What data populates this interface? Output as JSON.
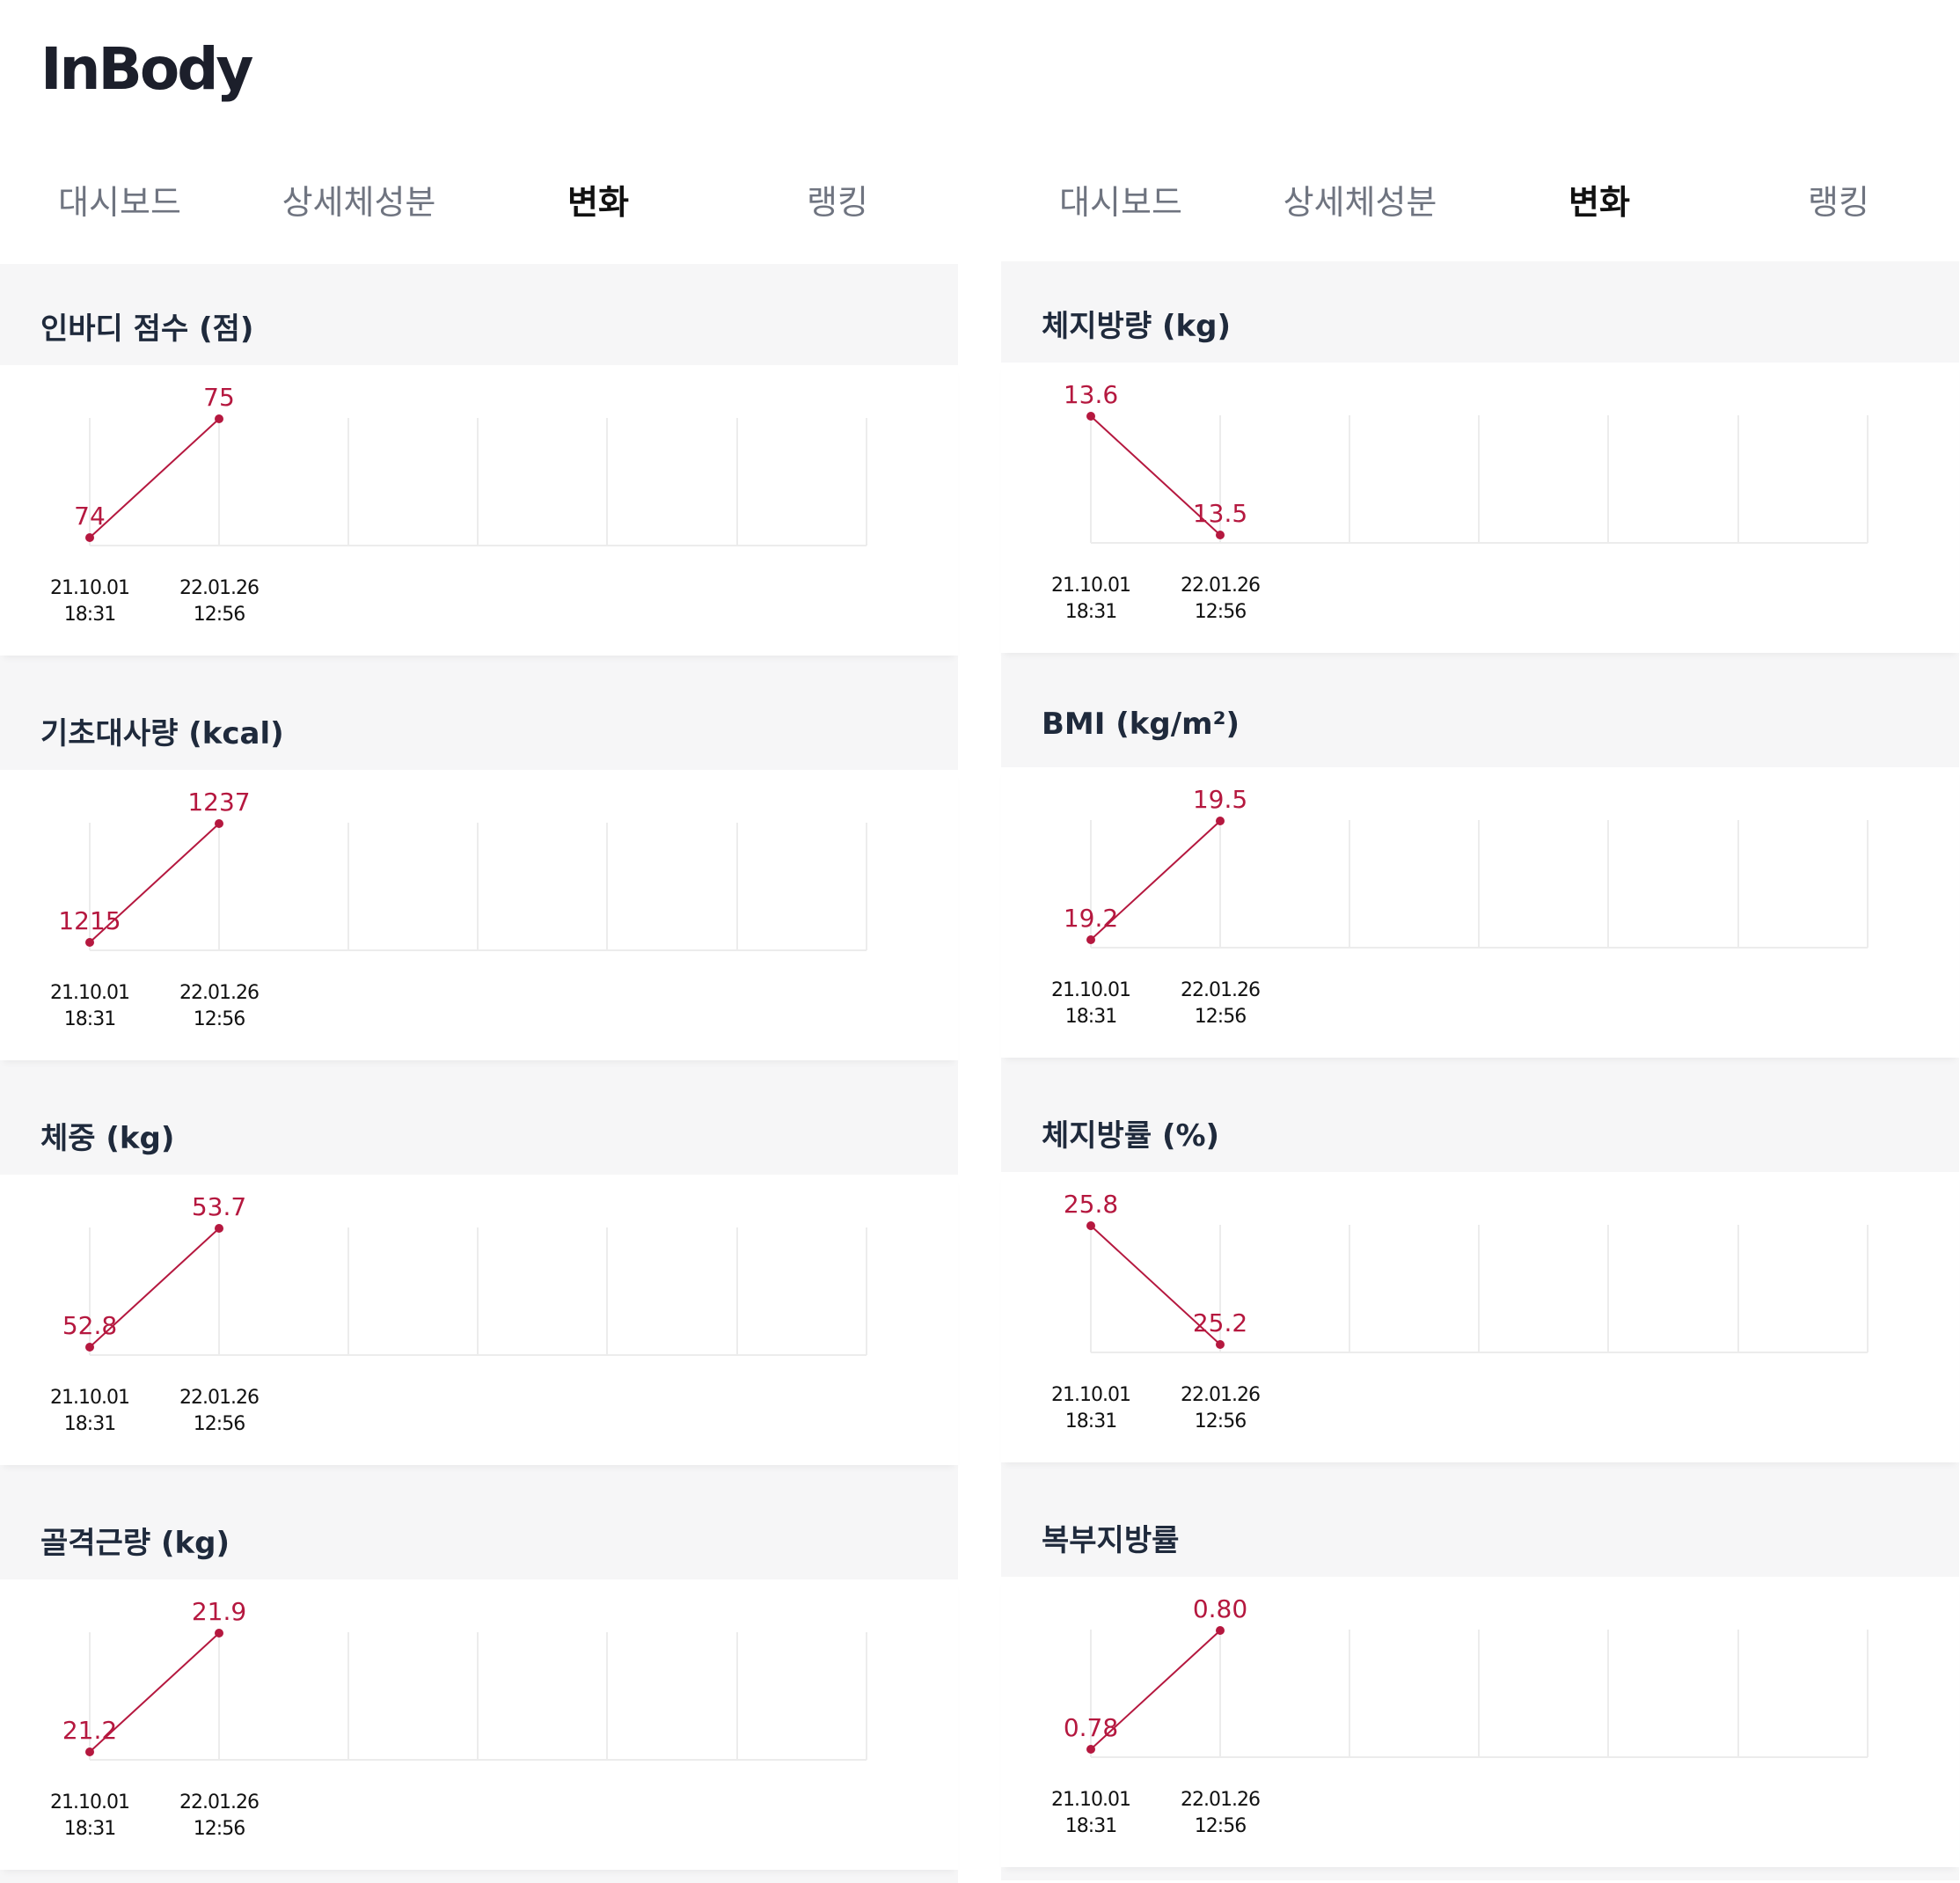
{
  "logo": {
    "text": "InBody"
  },
  "tabs": [
    {
      "label": "대시보드",
      "active": false
    },
    {
      "label": "상세체성분",
      "active": false
    },
    {
      "label": "변화",
      "active": true
    },
    {
      "label": "랭킹",
      "active": false
    }
  ],
  "dates": [
    {
      "date": "21.10.01",
      "time": "18:31"
    },
    {
      "date": "22.01.26",
      "time": "12:56"
    }
  ],
  "colors": {
    "series": "#b5183f",
    "header_bg": "#f6f6f7",
    "grid": "#ececec"
  },
  "chart_data": [
    {
      "type": "line",
      "title": "인바디 점수 (점)",
      "x": [
        "21.10.01 18:31",
        "22.01.26 12:56"
      ],
      "labels": [
        "74",
        "75"
      ],
      "values": [
        74,
        75
      ]
    },
    {
      "type": "line",
      "title": "기초대사량 (kcal)",
      "x": [
        "21.10.01 18:31",
        "22.01.26 12:56"
      ],
      "labels": [
        "1215",
        "1237"
      ],
      "values": [
        1215,
        1237
      ]
    },
    {
      "type": "line",
      "title": "체중 (kg)",
      "x": [
        "21.10.01 18:31",
        "22.01.26 12:56"
      ],
      "labels": [
        "52.8",
        "53.7"
      ],
      "values": [
        52.8,
        53.7
      ]
    },
    {
      "type": "line",
      "title": "골격근량 (kg)",
      "x": [
        "21.10.01 18:31",
        "22.01.26 12:56"
      ],
      "labels": [
        "21.2",
        "21.9"
      ],
      "values": [
        21.2,
        21.9
      ]
    },
    {
      "type": "line",
      "title": "체지방량 (kg)",
      "x": [
        "21.10.01 18:31",
        "22.01.26 12:56"
      ],
      "labels": [
        "13.6",
        "13.5"
      ],
      "values": [
        13.6,
        13.5
      ]
    },
    {
      "type": "line",
      "title": "BMI (kg/m²)",
      "x": [
        "21.10.01 18:31",
        "22.01.26 12:56"
      ],
      "labels": [
        "19.2",
        "19.5"
      ],
      "values": [
        19.2,
        19.5
      ]
    },
    {
      "type": "line",
      "title": "체지방률 (%)",
      "x": [
        "21.10.01 18:31",
        "22.01.26 12:56"
      ],
      "labels": [
        "25.8",
        "25.2"
      ],
      "values": [
        25.8,
        25.2
      ]
    },
    {
      "type": "line",
      "title": "복부지방률",
      "x": [
        "21.10.01 18:31",
        "22.01.26 12:56"
      ],
      "labels": [
        "0.78",
        "0.80"
      ],
      "values": [
        0.78,
        0.8
      ]
    }
  ]
}
